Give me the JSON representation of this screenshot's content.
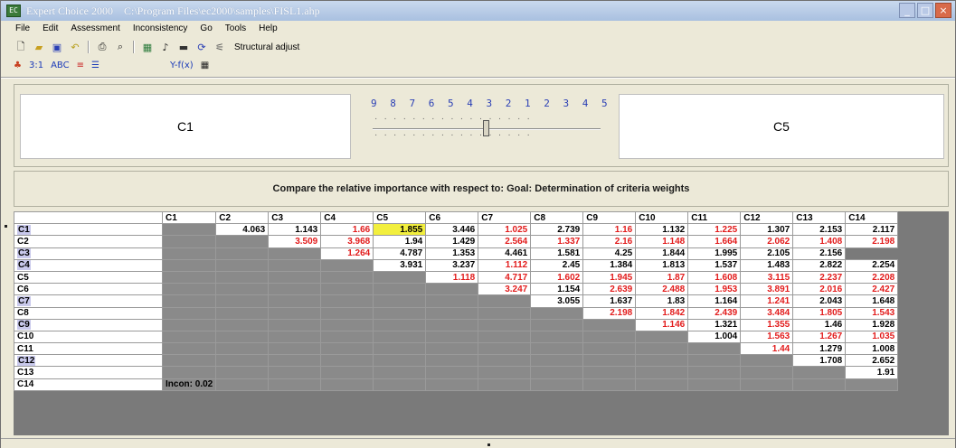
{
  "window": {
    "app_icon": "EC",
    "title": "Expert Choice 2000    C:\\Program Files\\ec2000\\samples\\FISL1.ahp",
    "controls": [
      "minimize-icon",
      "maximize-icon",
      "close-icon"
    ]
  },
  "menu": [
    "File",
    "Edit",
    "Assessment",
    "Inconsistency",
    "Go",
    "Tools",
    "Help"
  ],
  "toolbar": {
    "icons": [
      "new-file-icon",
      "open-folder-icon",
      "save-icon",
      "undo-icon",
      "print-icon",
      "print-preview-icon",
      "calculator-icon",
      "music-note-icon",
      "monitor-icon",
      "refresh-icon",
      "wand-icon"
    ],
    "structural_label": "Structural adjust"
  },
  "toolbar2": {
    "items": [
      "3:1",
      "ABC",
      "Y-f(x)"
    ]
  },
  "comparison": {
    "left": "C1",
    "right": "C5",
    "scale": "9 8 7 6 5 4 3 2 1 2 3 4 5 6 7 8 9",
    "position": 0.5
  },
  "prompt": "Compare the relative importance  with respect to: Goal: Determination of criteria weights",
  "matrix": {
    "headers": [
      "C1",
      "C2",
      "C3",
      "C4",
      "C5",
      "C6",
      "C7",
      "C8",
      "C9",
      "C10",
      "C11",
      "C12",
      "C13",
      "C14"
    ],
    "rows": [
      {
        "label": "C1",
        "cells": [
          {
            "v": "4.063",
            "r": false
          },
          {
            "v": "1.143",
            "r": false
          },
          {
            "v": "1.66",
            "r": true
          },
          {
            "v": "1.855",
            "r": false,
            "sel": true
          },
          {
            "v": "3.446",
            "r": false
          },
          {
            "v": "1.025",
            "r": true
          },
          {
            "v": "2.739",
            "r": false
          },
          {
            "v": "1.16",
            "r": true
          },
          {
            "v": "1.132",
            "r": false
          },
          {
            "v": "1.225",
            "r": true
          },
          {
            "v": "1.307",
            "r": false
          },
          {
            "v": "2.153",
            "r": false
          },
          {
            "v": "2.117",
            "r": false
          }
        ]
      },
      {
        "label": "C2",
        "cells": [
          {
            "v": "3.509",
            "r": true
          },
          {
            "v": "3.968",
            "r": true
          },
          {
            "v": "1.94",
            "r": false
          },
          {
            "v": "1.429",
            "r": false
          },
          {
            "v": "2.564",
            "r": true
          },
          {
            "v": "1.337",
            "r": true
          },
          {
            "v": "2.16",
            "r": true
          },
          {
            "v": "1.148",
            "r": true
          },
          {
            "v": "1.664",
            "r": true
          },
          {
            "v": "2.062",
            "r": true
          },
          {
            "v": "1.408",
            "r": true
          },
          {
            "v": "2.198",
            "r": true
          }
        ]
      },
      {
        "label": "C3",
        "cells": [
          {
            "v": "1.264",
            "r": true
          },
          {
            "v": "4.787",
            "r": false
          },
          {
            "v": "1.353",
            "r": false
          },
          {
            "v": "4.461",
            "r": false
          },
          {
            "v": "1.581",
            "r": false
          },
          {
            "v": "4.25",
            "r": false
          },
          {
            "v": "1.844",
            "r": false
          },
          {
            "v": "1.995",
            "r": false
          },
          {
            "v": "2.105",
            "r": false
          },
          {
            "v": "2.156",
            "r": false
          }
        ]
      },
      {
        "label": "C4",
        "cells": [
          {
            "v": "3.931",
            "r": false
          },
          {
            "v": "3.237",
            "r": false
          },
          {
            "v": "1.112",
            "r": true
          },
          {
            "v": "2.45",
            "r": false
          },
          {
            "v": "1.384",
            "r": false
          },
          {
            "v": "1.813",
            "r": false
          },
          {
            "v": "1.537",
            "r": false
          },
          {
            "v": "1.483",
            "r": false
          },
          {
            "v": "2.822",
            "r": false
          },
          {
            "v": "2.254",
            "r": false
          }
        ]
      },
      {
        "label": "C5",
        "cells": [
          {
            "v": "1.118",
            "r": true
          },
          {
            "v": "4.717",
            "r": true
          },
          {
            "v": "1.602",
            "r": true
          },
          {
            "v": "1.945",
            "r": true
          },
          {
            "v": "1.87",
            "r": true
          },
          {
            "v": "1.608",
            "r": true
          },
          {
            "v": "3.115",
            "r": true
          },
          {
            "v": "2.237",
            "r": true
          },
          {
            "v": "2.208",
            "r": true
          }
        ]
      },
      {
        "label": "C6",
        "cells": [
          {
            "v": "3.247",
            "r": true
          },
          {
            "v": "1.154",
            "r": false
          },
          {
            "v": "2.639",
            "r": true
          },
          {
            "v": "2.488",
            "r": true
          },
          {
            "v": "1.953",
            "r": true
          },
          {
            "v": "3.891",
            "r": true
          },
          {
            "v": "2.016",
            "r": true
          },
          {
            "v": "2.427",
            "r": true
          }
        ]
      },
      {
        "label": "C7",
        "cells": [
          {
            "v": "3.055",
            "r": false
          },
          {
            "v": "1.637",
            "r": false
          },
          {
            "v": "1.83",
            "r": false
          },
          {
            "v": "1.164",
            "r": false
          },
          {
            "v": "1.241",
            "r": true
          },
          {
            "v": "2.043",
            "r": false
          },
          {
            "v": "1.648",
            "r": false
          }
        ]
      },
      {
        "label": "C8",
        "cells": [
          {
            "v": "2.198",
            "r": true
          },
          {
            "v": "1.842",
            "r": true
          },
          {
            "v": "2.439",
            "r": true
          },
          {
            "v": "3.484",
            "r": true
          },
          {
            "v": "1.805",
            "r": true
          },
          {
            "v": "1.543",
            "r": true
          }
        ]
      },
      {
        "label": "C9",
        "cells": [
          {
            "v": "1.146",
            "r": true
          },
          {
            "v": "1.321",
            "r": false
          },
          {
            "v": "1.355",
            "r": true
          },
          {
            "v": "1.46",
            "r": false
          },
          {
            "v": "1.928",
            "r": false
          }
        ]
      },
      {
        "label": "C10",
        "cells": [
          {
            "v": "1.004",
            "r": false
          },
          {
            "v": "1.563",
            "r": true
          },
          {
            "v": "1.267",
            "r": true
          },
          {
            "v": "1.035",
            "r": true
          }
        ]
      },
      {
        "label": "C11",
        "cells": [
          {
            "v": "1.44",
            "r": true
          },
          {
            "v": "1.279",
            "r": false
          },
          {
            "v": "1.008",
            "r": false
          }
        ]
      },
      {
        "label": "C12",
        "cells": [
          {
            "v": "1.708",
            "r": false
          },
          {
            "v": "2.652",
            "r": false
          }
        ]
      },
      {
        "label": "C13",
        "cells": [
          {
            "v": "1.91",
            "r": false
          }
        ]
      },
      {
        "label": "C14",
        "cells": []
      }
    ],
    "incon": "Incon: 0.02"
  }
}
